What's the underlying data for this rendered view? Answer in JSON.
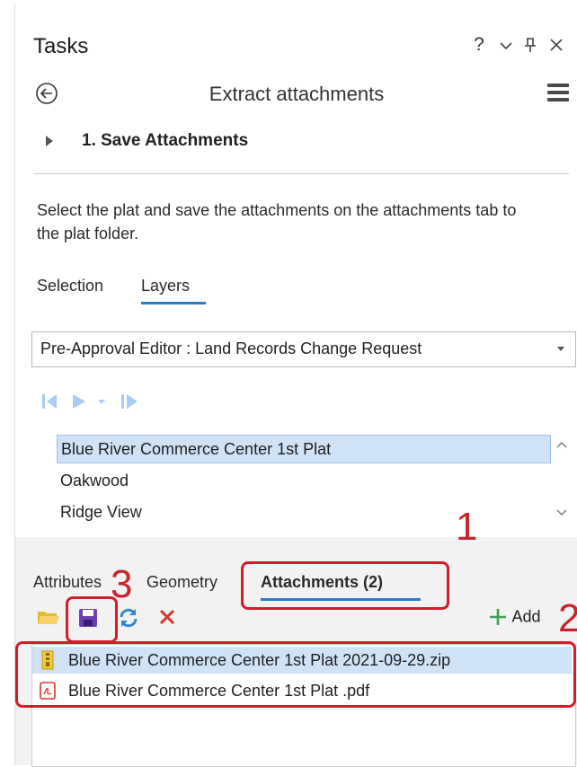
{
  "pane": {
    "title": "Tasks",
    "toolbar": {
      "help": "?",
      "options": "⌄",
      "pin": "Ⅎ",
      "close": "✕"
    }
  },
  "header": {
    "title": "Extract attachments"
  },
  "step": {
    "label": "1. Save Attachments"
  },
  "description": "Select the plat and save the attachments on the attachments tab to the plat folder.",
  "top_tabs": [
    {
      "label": "Selection"
    },
    {
      "label": "Layers"
    }
  ],
  "layer_dropdown": {
    "selected": "Pre-Approval Editor : Land Records Change Request"
  },
  "feature_list": [
    {
      "label": "Blue River Commerce Center 1st Plat",
      "selected": true
    },
    {
      "label": "Oakwood",
      "selected": false
    },
    {
      "label": "Ridge View",
      "selected": false
    }
  ],
  "bottom_tabs": [
    {
      "label": "Attributes"
    },
    {
      "label": "Geometry"
    },
    {
      "label": "Attachments (2)"
    }
  ],
  "add_button": {
    "label": "Add"
  },
  "attachments": [
    {
      "name": "Blue River Commerce Center 1st Plat 2021-09-29.zip",
      "icon": "zip-icon",
      "selected": true
    },
    {
      "name": "Blue River Commerce Center 1st Plat .pdf",
      "icon": "pdf-icon",
      "selected": false
    }
  ],
  "annotations": {
    "n1": "1",
    "n2": "2",
    "n3": "3"
  },
  "colors": {
    "accent": "#2c7bc5",
    "annotation": "#d41c2a",
    "selection": "#cfe2f6"
  }
}
